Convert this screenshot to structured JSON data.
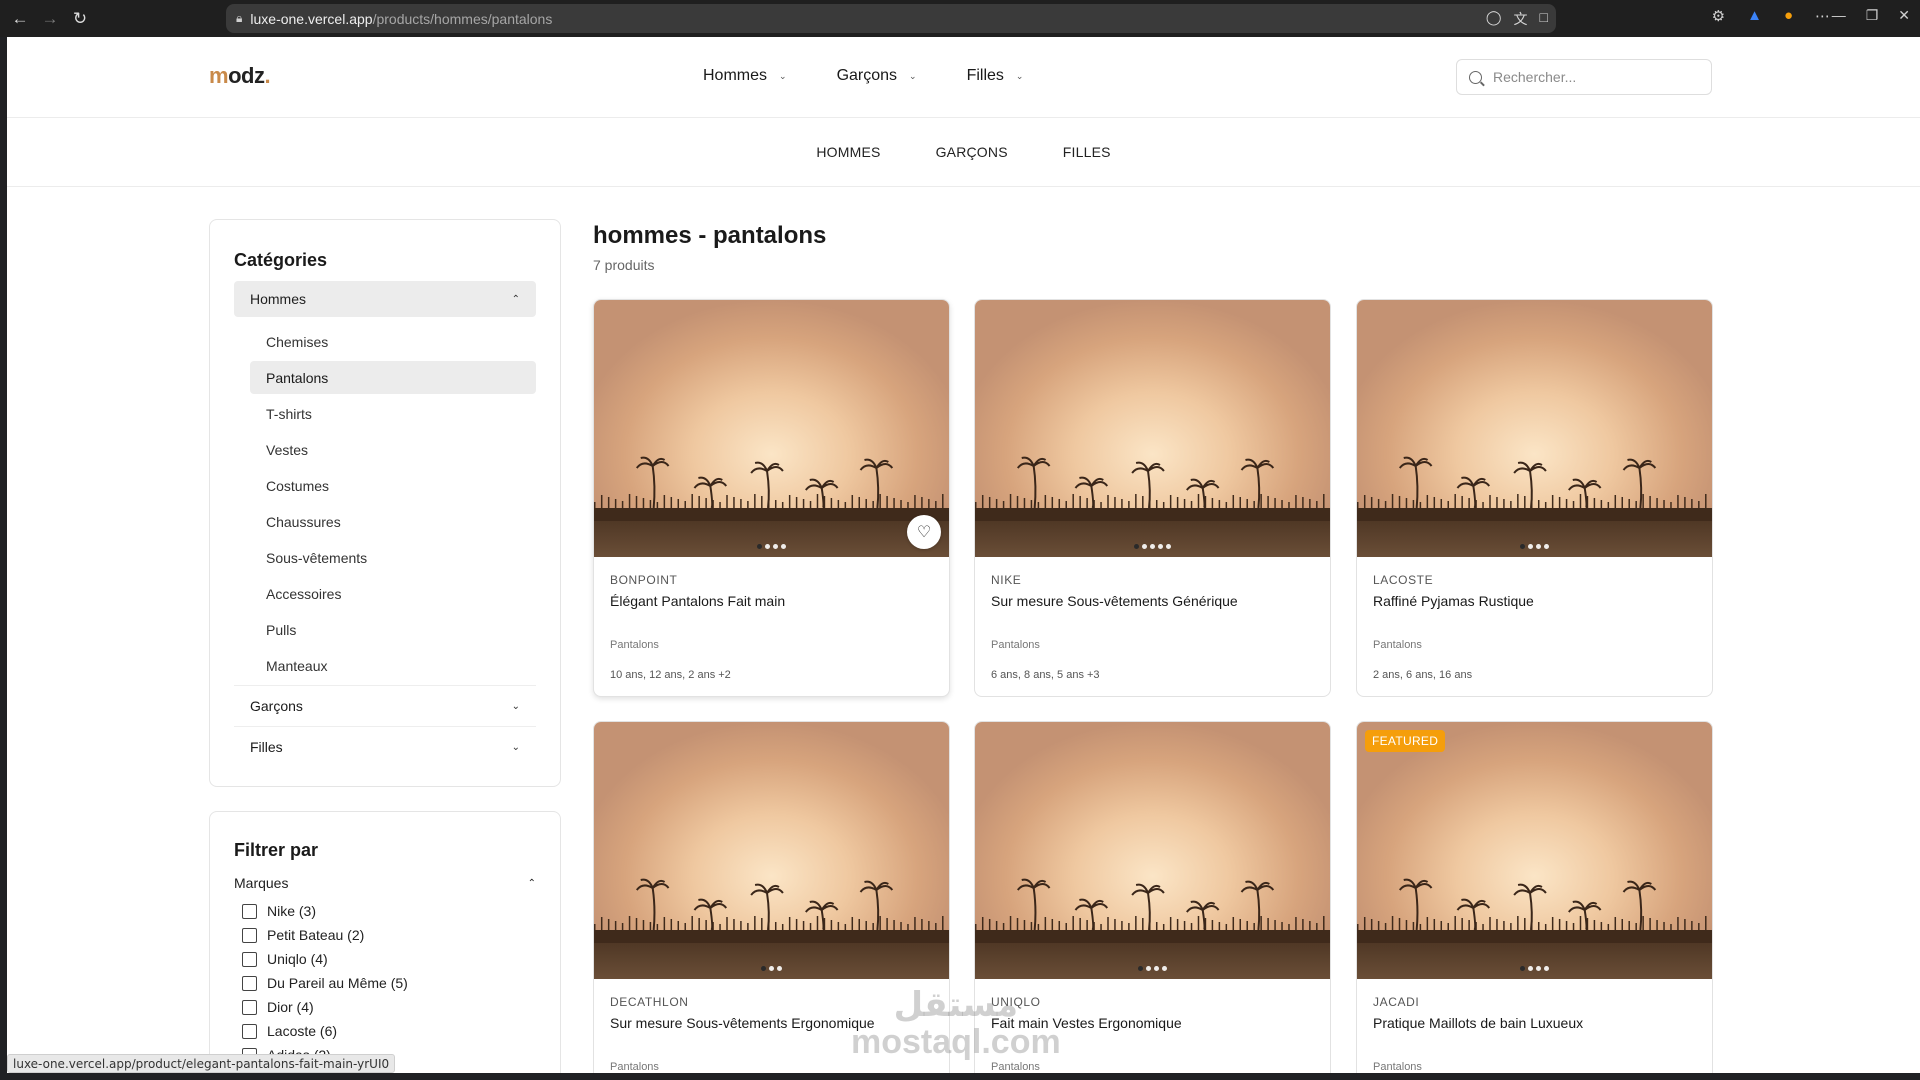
{
  "browser": {
    "url_domain": "luxe-one.vercel.app",
    "url_path": "/products/hommes/pantalons",
    "status_url": "luxe-one.vercel.app/product/elegant-pantalons-fait-main-yrUI0"
  },
  "header": {
    "logo_m": "m",
    "logo_rest": "odz",
    "logo_dot": ".",
    "nav": [
      "Hommes",
      "Garçons",
      "Filles"
    ],
    "search_placeholder": "Rechercher..."
  },
  "subnav": [
    "HOMMES",
    "GARÇONS",
    "FILLES"
  ],
  "sidebar": {
    "categories_title": "Catégories",
    "open_category": "Hommes",
    "subcategories": [
      "Chemises",
      "Pantalons",
      "T-shirts",
      "Vestes",
      "Costumes",
      "Chaussures",
      "Sous-vêtements",
      "Accessoires",
      "Pulls",
      "Manteaux"
    ],
    "active_subcategory_index": 1,
    "other_categories": [
      "Garçons",
      "Filles"
    ],
    "filter_title": "Filtrer par",
    "brands_label": "Marques",
    "brands": [
      "Nike (3)",
      "Petit Bateau (2)",
      "Uniqlo (4)",
      "Du Pareil au Même (5)",
      "Dior (4)",
      "Lacoste (6)",
      "Adidas (2)"
    ]
  },
  "main": {
    "title": "hommes - pantalons",
    "count": "7 produits"
  },
  "products": [
    {
      "brand": "BONPOINT",
      "name": "Élégant Pantalons Fait main",
      "category": "Pantalons",
      "sizes": "10 ans, 12 ans, 2 ans +2",
      "dots": 4,
      "active_dot": 0,
      "badge": ""
    },
    {
      "brand": "NIKE",
      "name": "Sur mesure Sous-vêtements Générique",
      "category": "Pantalons",
      "sizes": "6 ans, 8 ans, 5 ans +3",
      "dots": 5,
      "active_dot": 0,
      "badge": ""
    },
    {
      "brand": "LACOSTE",
      "name": "Raffiné Pyjamas Rustique",
      "category": "Pantalons",
      "sizes": "2 ans, 6 ans, 16 ans",
      "dots": 4,
      "active_dot": 0,
      "badge": ""
    },
    {
      "brand": "DECATHLON",
      "name": "Sur mesure Sous-vêtements Ergonomique",
      "category": "Pantalons",
      "sizes": "",
      "dots": 3,
      "active_dot": 0,
      "badge": ""
    },
    {
      "brand": "UNIQLO",
      "name": "Fait main Vestes Ergonomique",
      "category": "Pantalons",
      "sizes": "",
      "dots": 4,
      "active_dot": 0,
      "badge": ""
    },
    {
      "brand": "JACADI",
      "name": "Pratique Maillots de bain Luxueux",
      "category": "Pantalons",
      "sizes": "",
      "dots": 4,
      "active_dot": 0,
      "badge": "FEATURED"
    }
  ],
  "watermark": {
    "line1": "مستقل",
    "line2": "mostaql.com"
  },
  "colors": {
    "accent": "#c98a4a",
    "badge": "#f59e0b"
  }
}
